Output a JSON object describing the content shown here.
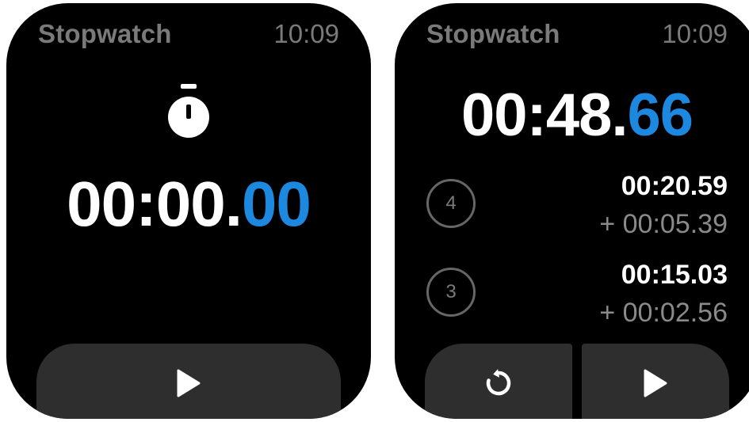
{
  "screens": {
    "left": {
      "title": "Stopwatch",
      "clock": "10:09",
      "timer": {
        "main": "00:00.",
        "fraction": "00"
      },
      "icon": "stopwatch-icon",
      "start_button_icon": "play-icon"
    },
    "right": {
      "title": "Stopwatch",
      "clock": "10:09",
      "timer": {
        "main": "00:48.",
        "fraction": "66"
      },
      "laps": [
        {
          "number": "4",
          "total": "00:20.59",
          "split": "+ 00:05.39"
        },
        {
          "number": "3",
          "total": "00:15.03",
          "split": "+ 00:02.56"
        }
      ],
      "reset_button_icon": "reset-icon",
      "start_button_icon": "play-icon"
    }
  },
  "colors": {
    "accent": "#1d88e0",
    "background": "#000000",
    "button": "#2e2e2e",
    "muted": "#7a7a7a"
  }
}
